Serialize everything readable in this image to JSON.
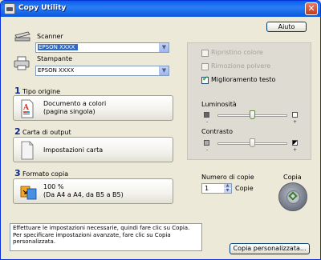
{
  "window": {
    "title": "Copy Utility",
    "close_glyph": "✕"
  },
  "help_button": "Aiuto",
  "scanner": {
    "label": "Scanner",
    "selected": "EPSON XXXX"
  },
  "printer": {
    "label": "Stampante",
    "selected": "EPSON XXXX"
  },
  "sections": [
    {
      "number": "1",
      "label": "Tipo origine",
      "line1": "Documento a colori",
      "line2": "(pagina singola)"
    },
    {
      "number": "2",
      "label": "Carta di output",
      "line1": "Impostazioni carta",
      "line2": ""
    },
    {
      "number": "3",
      "label": "Formato copia",
      "line1": "100 %",
      "line2": "(Da A4 a A4, da B5 a B5)"
    }
  ],
  "options": {
    "restore_color": {
      "label": "Ripristino colore",
      "checked": false,
      "enabled": false
    },
    "dust_removal": {
      "label": "Rimozione polvere",
      "checked": false,
      "enabled": false
    },
    "text_enhancement": {
      "label": "Miglioramento testo",
      "checked": true,
      "enabled": true
    }
  },
  "brightness": {
    "label": "Luminosità",
    "minus": "-",
    "plus": "+",
    "value": 0
  },
  "contrast": {
    "label": "Contrasto",
    "minus": "-",
    "plus": "+",
    "value": 0
  },
  "copies": {
    "label": "Numero di copie",
    "value": "1",
    "unit": "Copie"
  },
  "copy_button_label": "Copia",
  "info": {
    "line1": "Effettuare le impostazioni necessarie, quindi fare clic su Copia.",
    "line2": "Per specificare impostazioni avanzate, fare clic su Copia",
    "line3": "personalizzata."
  },
  "custom_copy_button": "Copia personalizzata...",
  "colors": {
    "titlebar": "#0a5ee8",
    "accent_green": "#21a121",
    "section_number": "#0a2a8a"
  },
  "icons": [
    "app-icon",
    "close-icon",
    "scanner-icon",
    "printer-icon",
    "color-document-icon",
    "paper-icon",
    "copy-size-icon",
    "brightness-dark-icon",
    "brightness-light-icon",
    "contrast-low-icon",
    "contrast-high-icon",
    "copy-start-icon"
  ]
}
